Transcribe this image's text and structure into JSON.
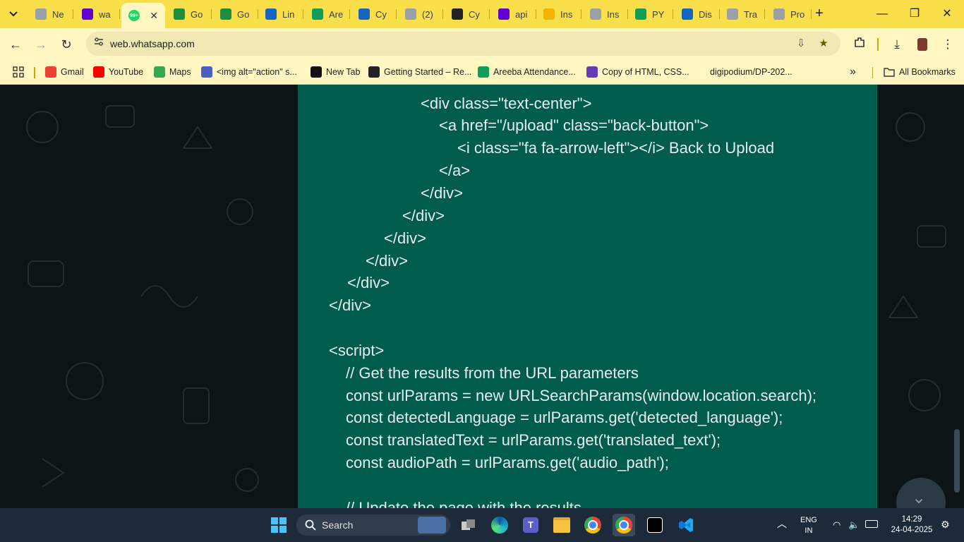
{
  "tabs": [
    {
      "label": "Ne",
      "favicon": "globe-icon",
      "color": "#9aa0a6"
    },
    {
      "label": "wa",
      "favicon": "yahoo-icon",
      "color": "#6001d2"
    },
    {
      "label": "",
      "favicon": "whatsapp-icon",
      "color": "#25d366",
      "badge": "99+",
      "active": true
    },
    {
      "label": "Go",
      "favicon": "google-classroom-icon",
      "color": "#1e8e3e"
    },
    {
      "label": "Go",
      "favicon": "google-classroom-icon",
      "color": "#1e8e3e"
    },
    {
      "label": "Lin",
      "favicon": "k-icon",
      "color": "#1565c0"
    },
    {
      "label": "Are",
      "favicon": "sheets-icon",
      "color": "#0f9d58"
    },
    {
      "label": "Cy",
      "favicon": "k-icon",
      "color": "#1565c0"
    },
    {
      "label": "(2)",
      "favicon": "globe-icon",
      "color": "#9aa0a6"
    },
    {
      "label": "Cy",
      "favicon": "openai-icon",
      "color": "#222222"
    },
    {
      "label": "api",
      "favicon": "yahoo-icon",
      "color": "#6001d2"
    },
    {
      "label": "Ins",
      "favicon": "firebase-icon",
      "color": "#f4b400"
    },
    {
      "label": "Ins",
      "favicon": "globe-icon",
      "color": "#9aa0a6"
    },
    {
      "label": "PY",
      "favicon": "sheets-icon",
      "color": "#0f9d58"
    },
    {
      "label": "Dis",
      "favicon": "k-icon",
      "color": "#1565c0"
    },
    {
      "label": "Tra",
      "favicon": "globe-icon",
      "color": "#9aa0a6"
    },
    {
      "label": "Pro",
      "favicon": "globe-icon",
      "color": "#9aa0a6"
    }
  ],
  "address": {
    "url": "web.whatsapp.com"
  },
  "bookmarks": [
    {
      "label": "Gmail",
      "icon": "gmail-icon",
      "color": "#ea4335"
    },
    {
      "label": "YouTube",
      "icon": "youtube-icon",
      "color": "#ff0000"
    },
    {
      "label": "Maps",
      "icon": "maps-icon",
      "color": "#34a853"
    },
    {
      "label": "<img alt=\"action\" s...",
      "icon": "g-icon",
      "color": "#4a5fc1"
    },
    {
      "label": "New Tab",
      "icon": "github-icon",
      "color": "#111111"
    },
    {
      "label": "Getting Started – Re...",
      "icon": "react-icon",
      "color": "#20232a"
    },
    {
      "label": "Areeba Attendance...",
      "icon": "sheets-icon",
      "color": "#0f9d58"
    },
    {
      "label": "Copy of HTML, CSS...",
      "icon": "forms-icon",
      "color": "#673ab7"
    },
    {
      "label": "digipodium/DP-202...",
      "icon": "",
      "color": "#fff6c2"
    }
  ],
  "bookmarks_more": "»",
  "all_bookmarks": "All Bookmarks",
  "code_lines": [
    "<div class=\"text-center\">",
    "<a href=\"/upload\" class=\"back-button\">",
    "<i class=\"fa fa-arrow-left\"></i> Back to Upload",
    "</a>",
    "</div>",
    "</div>",
    "</div>",
    "</div>",
    "</div>",
    "</div>",
    "",
    "<script>",
    "// Get the results from the URL parameters",
    "const urlParams = new URLSearchParams(window.location.search);",
    "const detectedLanguage = urlParams.get('detected_language');",
    "const translatedText = urlParams.get('translated_text');",
    "const audioPath = urlParams.get('audio_path');",
    "",
    "// Update the page with the results"
  ],
  "taskbar": {
    "search_label": "Search",
    "lang_top": "ENG",
    "lang_bottom": "IN",
    "time": "14:29",
    "date": "24-04-2025"
  },
  "colors": {
    "chrome": "#f9df4a",
    "toolbar": "#fff6c2",
    "bubble": "#005c4b",
    "taskbar": "#1c2a3a"
  }
}
